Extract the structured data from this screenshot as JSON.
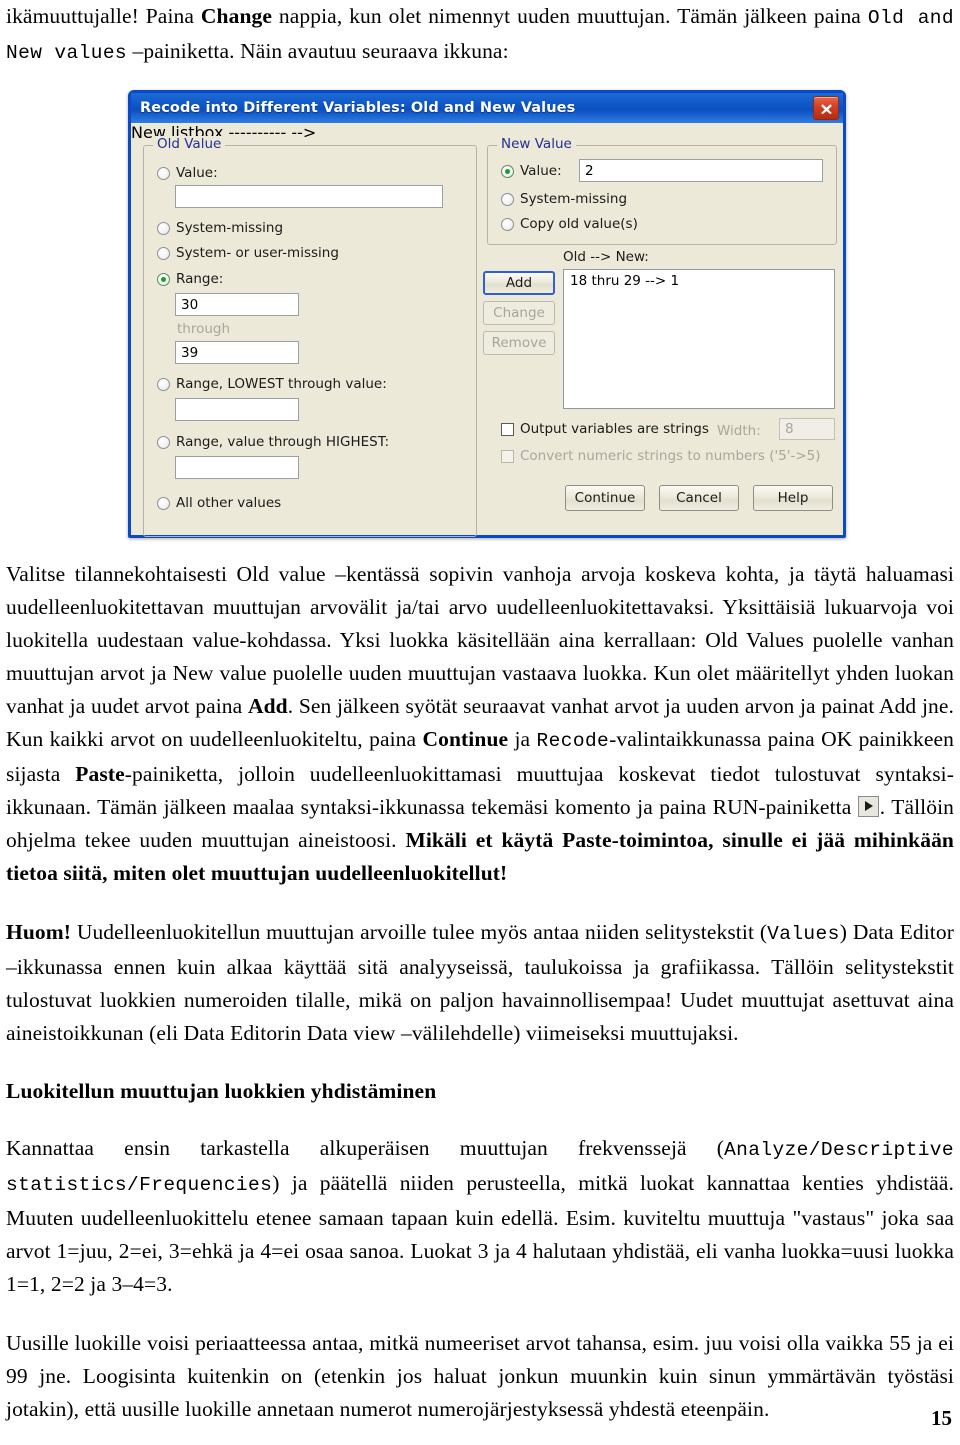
{
  "document": {
    "page_number": "15",
    "intro": {
      "line1_a": "ikämuuttujalle! Paina ",
      "line1_bold": "Change",
      "line1_b": " nappia, kun olet nimennyt uuden muuttujan. Tämän jälkeen paina ",
      "line1_mono": "Old and New values",
      "line1_c": " –painiketta. Näin avautuu seuraava ikkuna:"
    },
    "para2": {
      "t1": "Valitse tilannekohtaisesti Old value –kentässä sopivin vanhoja arvoja koskeva kohta, ja täytä haluamasi uudelleenluokitettavan muuttujan arvovälit ja/tai arvo uudelleenluokitettavaksi. Yksittäisiä lukuarvoja voi luokitella uudestaan value-kohdassa. Yksi luokka käsitellään aina kerrallaan: Old Values puolelle vanhan muuttujan arvot ja New value puolelle uuden muuttujan vastaava luokka. Kun olet määritellyt yhden luokan vanhat ja uudet arvot paina ",
      "b1": "Add",
      "t2": ". Sen jälkeen syötät seuraavat vanhat arvot ja uuden arvon ja painat Add jne. Kun kaikki arvot on uudelleenluokiteltu, paina ",
      "b2": "Continue",
      "t3": " ja ",
      "m1": "Recode",
      "t4": "-valintaikkunassa paina OK painikkeen sijasta ",
      "b3": "Paste",
      "t5": "-painiketta, jolloin uudelleenluokittamasi muuttujaa koskevat tiedot tulostuvat syntaksi-ikkunaan. Tämän jälkeen maalaa syntaksi-ikkunassa tekemäsi komento ja paina RUN-painiketta ",
      "run_icon": "run-button-icon",
      "t6": ". Tällöin ohjelma tekee uuden muuttujan aineistoosi. ",
      "b4": "Mikäli et käytä Paste-toimintoa, sinulle ei jää mihinkään tietoa siitä, miten olet muuttujan uudelleenluokitellut!"
    },
    "para3": {
      "b1": "Huom!",
      "t1": " Uudelleenluokitellun muuttujan arvoille tulee myös antaa niiden selitystekstit (",
      "m1": "Values",
      "t2": ") Data Editor –ikkunassa ennen kuin alkaa käyttää sitä analyyseissä, taulukoissa ja grafiikassa. Tällöin selitystekstit tulostuvat luokkien numeroiden tilalle, mikä on paljon havainnollisempaa! Uudet muuttujat asettuvat aina aineistoikkunan (eli Data Editorin Data view –välilehdelle) viimeiseksi muuttujaksi."
    },
    "heading": "Luokitellun muuttujan luokkien yhdistäminen",
    "para4": {
      "t1": "Kannattaa ensin tarkastella alkuperäisen muuttujan frekvenssejä (",
      "m1": "Analyze/Descriptive statistics/Frequencies",
      "t2": ") ja päätellä niiden perusteella, mitkä luokat kannattaa kenties yhdistää. Muuten uudelleenluokittelu etenee samaan tapaan kuin edellä. Esim. kuviteltu muuttuja \"vastaus\" joka saa arvot 1=juu, 2=ei, 3=ehkä ja 4=ei osaa sanoa. Luokat 3 ja 4 halutaan yhdistää, eli vanha luokka=uusi luokka 1=1, 2=2 ja 3–4=3."
    },
    "para5": {
      "t1": "Uusille luokille voisi periaatteessa antaa, mitkä numeeriset arvot tahansa, esim. juu voisi olla vaikka 55 ja ei 99 jne. Loogisinta kuitenkin on (etenkin jos haluat jonkun muunkin kuin sinun ymmärtävän työstäsi jotakin), että uusille luokille annetaan numerot numerojärjestyksessä yhdestä eteenpäin."
    }
  },
  "dialog": {
    "title": "Recode into Different Variables: Old and New Values",
    "close_icon": "close-icon",
    "old_value": {
      "legend": "Old Value",
      "options": [
        {
          "label": "Value:",
          "mnemonic": "V",
          "selected": false
        },
        {
          "label": "System-missing",
          "mnemonic": "S",
          "selected": false
        },
        {
          "label": "System- or user-missing",
          "mnemonic": "u",
          "selected": false
        },
        {
          "label": "Range:",
          "mnemonic": "g",
          "selected": true
        },
        {
          "label": "Range, LOWEST through value:",
          "mnemonic": "g",
          "selected": false
        },
        {
          "label": "Range, value through HIGHEST:",
          "mnemonic": "g",
          "selected": false
        },
        {
          "label": "All other values",
          "mnemonic": "o",
          "selected": false
        }
      ],
      "value_field": "",
      "range_from": "30",
      "range_through_label": "through",
      "range_to": "39",
      "lowest_field": "",
      "highest_field": ""
    },
    "new_value": {
      "legend": "New Value",
      "options": [
        {
          "label": "Value:",
          "selected": true
        },
        {
          "label": "System-missing",
          "selected": false
        },
        {
          "label": "Copy old value(s)",
          "selected": false
        }
      ],
      "value_field": "2"
    },
    "buttons": {
      "add": "Add",
      "change": "Change",
      "remove": "Remove"
    },
    "mapping": {
      "label": "Old --> New:",
      "items": [
        "18 thru 29 --> 1"
      ]
    },
    "options": {
      "output_strings_label": "Output variables are strings",
      "output_strings_checked": false,
      "width_label": "Width:",
      "width_value": "8",
      "convert_label": "Convert numeric strings to numbers ('5'->5)",
      "convert_checked": false
    },
    "footer": {
      "continue": "Continue",
      "cancel": "Cancel",
      "help": "Help"
    }
  },
  "colors": {
    "titlebar": "#0c52c4",
    "dialog_face": "#ece9d8",
    "legend_text": "#22308f",
    "close_red": "#d33f24",
    "radio_dot": "#1f9c29"
  }
}
